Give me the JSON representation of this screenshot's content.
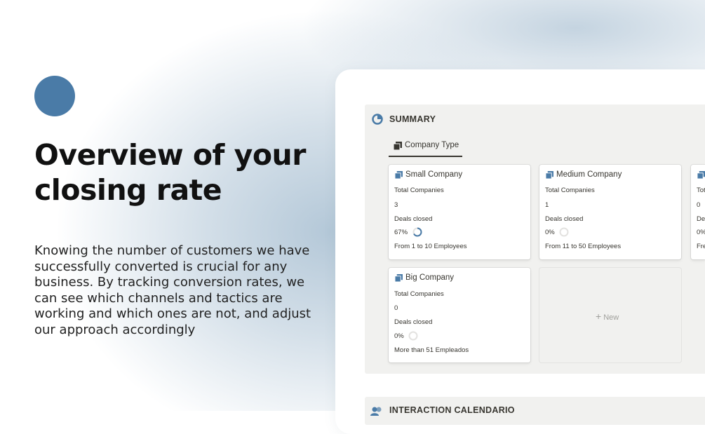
{
  "hero": {
    "title_line1": "Overview of your",
    "title_line2": "closing rate",
    "description": "Knowing the number of customers we have successfully converted is crucial for any business. By tracking conversion rates, we can see which channels and tactics are working and which ones are not, and adjust our approach accordingly"
  },
  "colors": {
    "accent": "#4a7ba7",
    "text": "#37352f",
    "panel_bg": "#f1f1ef"
  },
  "summary": {
    "icon": "pie-chart-icon",
    "title": "SUMMARY",
    "tab": {
      "icon": "cards-icon",
      "label": "Company Type"
    },
    "cards": [
      {
        "title": "Small Company",
        "total_label": "Total Companies",
        "total": "3",
        "deals_label": "Deals closed",
        "deals_pct": "67%",
        "deals_fraction": 0.67,
        "range": "From 1 to 10 Employees"
      },
      {
        "title": "Medium Company",
        "total_label": "Total Companies",
        "total": "1",
        "deals_label": "Deals closed",
        "deals_pct": "0%",
        "deals_fraction": 0,
        "range": "From 11 to 50 Employees"
      },
      {
        "title": "",
        "total_label": "Tot",
        "total": "0",
        "deals_label": "De",
        "deals_pct": "0%",
        "deals_fraction": 0,
        "range": "Fre"
      },
      {
        "title": "Big Company",
        "total_label": "Total Companies",
        "total": "0",
        "deals_label": "Deals closed",
        "deals_pct": "0%",
        "deals_fraction": 0,
        "range": "More than 51 Empleados"
      }
    ],
    "new_label": "New"
  },
  "calendar": {
    "icon": "users-icon",
    "title": "INTERACTION CALENDARIO"
  }
}
